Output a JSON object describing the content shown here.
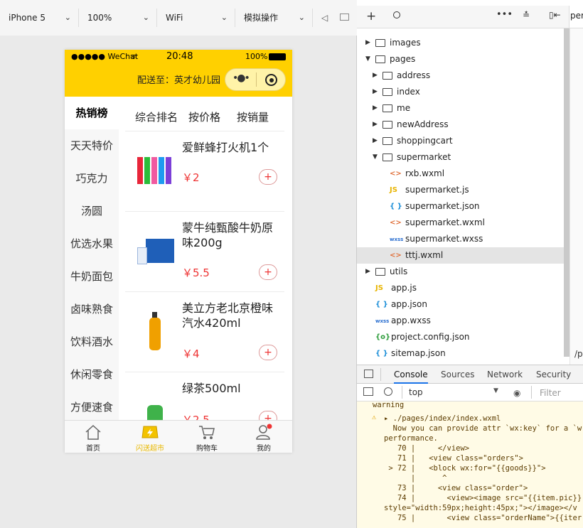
{
  "toolbar": {
    "device": "iPhone 5",
    "zoom": "100%",
    "network": "WiFi",
    "operation": "模拟操作"
  },
  "status": {
    "carrier": "●●●●● WeChat",
    "time": "20:48",
    "battery": "100%"
  },
  "header": {
    "delivery": "配送至：英才幼儿园"
  },
  "left_nav": [
    "热销榜",
    "天天特价",
    "巧克力",
    "汤圆",
    "优选水果",
    "牛奶面包",
    "卤味熟食",
    "饮料酒水",
    "休闲零食",
    "方便速食"
  ],
  "sort_tabs": [
    "综合排名",
    "按价格",
    "按销量"
  ],
  "products": [
    {
      "name": "爱鲜蜂打火机1个",
      "price": "￥2"
    },
    {
      "name": "蒙牛纯甄酸牛奶原味200g",
      "price": "￥5.5"
    },
    {
      "name": "美立方老北京橙味汽水420ml",
      "price": "￥4"
    },
    {
      "name": "绿茶500ml",
      "price": "￥2.5"
    }
  ],
  "tabbar": [
    "首页",
    "闪送超市",
    "购物车",
    "我的"
  ],
  "colors": {
    "accent": "#ffd000",
    "price": "#e33333",
    "tab_active": "#e8b800"
  },
  "files": {
    "images": "images",
    "pages": "pages",
    "address": "address",
    "index": "index",
    "me": "me",
    "newAddress": "newAddress",
    "shoppingcart": "shoppingcart",
    "supermarket": "supermarket",
    "rxb": "rxb.wxml",
    "smjs": "supermarket.js",
    "smjson": "supermarket.json",
    "smwxml": "supermarket.wxml",
    "smwxss": "supermarket.wxss",
    "tttj": "tttj.wxml",
    "utils": "utils",
    "appjs": "app.js",
    "appjson": "app.json",
    "appwxss": "app.wxss",
    "project": "project.config.json",
    "sitemap": "sitemap.json"
  },
  "devtools": {
    "tabs": [
      "Console",
      "Sources",
      "Network",
      "Security"
    ],
    "context": "top",
    "filter": "Filter"
  },
  "console_lines": [
    "warning",
    "▸ ./pages/index/index.wxml",
    "  Now you can provide attr `wx:key` for a `w",
    "performance.",
    "   70 |     </view>",
    "   71 |   <view class=\"orders\">",
    " > 72 |   <block wx:for=\"{{goods}}\">",
    "      |      ^",
    "   73 |     <view class=\"order\">",
    "   74 |       <view><image src=\"{{item.pic}}",
    "style=\"width:59px;height:45px;\"></image></v",
    "   75 |       <view class=\"orderName\">{{iter"
  ],
  "right_partial": "per",
  "right_partial2": "/p"
}
